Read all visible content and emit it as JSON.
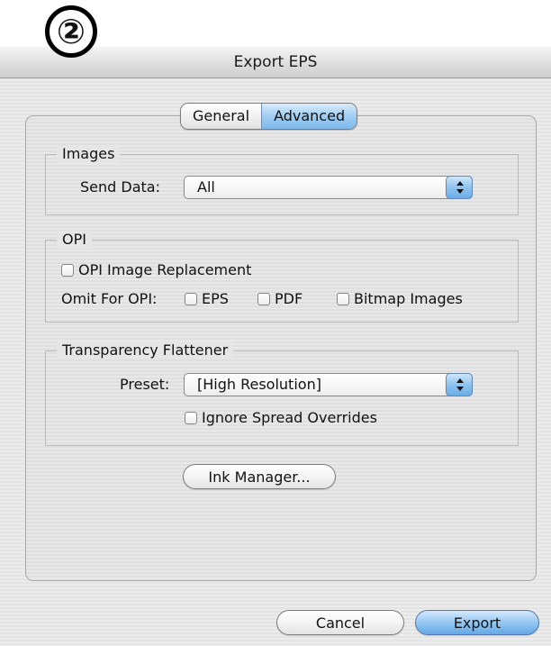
{
  "step_badge": "②",
  "window": {
    "title": "Export EPS"
  },
  "tabs": [
    {
      "label": "General",
      "selected": false
    },
    {
      "label": "Advanced",
      "selected": true
    }
  ],
  "images_group": {
    "title": "Images",
    "send_data_label": "Send Data:",
    "send_data_value": "All"
  },
  "opi_group": {
    "title": "OPI",
    "opi_image_replacement": {
      "label": "OPI Image Replacement",
      "checked": false
    },
    "omit_label": "Omit For OPI:",
    "omit_eps": {
      "label": "EPS",
      "checked": false
    },
    "omit_pdf": {
      "label": "PDF",
      "checked": false
    },
    "omit_bitmap": {
      "label": "Bitmap Images",
      "checked": false
    }
  },
  "transparency_group": {
    "title": "Transparency Flattener",
    "preset_label": "Preset:",
    "preset_value": "[High Resolution]",
    "ignore_spread_overrides": {
      "label": "Ignore Spread Overrides",
      "checked": false
    }
  },
  "ink_manager_button": "Ink Manager...",
  "cancel_button": "Cancel",
  "export_button": "Export",
  "colors": {
    "accent": "#7eb9ea",
    "default_button": "#64a8e6"
  }
}
